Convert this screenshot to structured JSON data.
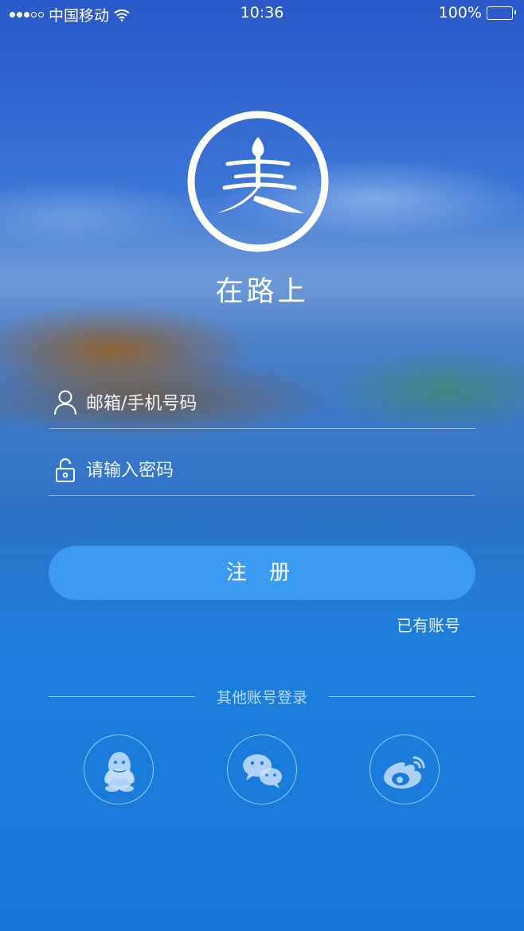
{
  "status_bar": {
    "carrier": "中国移动",
    "time": "10:36",
    "battery": "100%",
    "battery_level": 1.0
  },
  "app": {
    "title": "在路上"
  },
  "form": {
    "email_placeholder": "邮箱/手机号码",
    "password_placeholder": "请输入密码",
    "register_label": "注 册",
    "has_account_label": "已有账号"
  },
  "social_login": {
    "label": "其他账号登录",
    "providers": [
      {
        "icon": "qq-icon"
      },
      {
        "icon": "wechat-icon"
      },
      {
        "icon": "weibo-icon"
      }
    ]
  },
  "colors": {
    "accent": "#3b9bf3",
    "background_top": "#2a58c8",
    "background_bottom": "#1878d8"
  }
}
